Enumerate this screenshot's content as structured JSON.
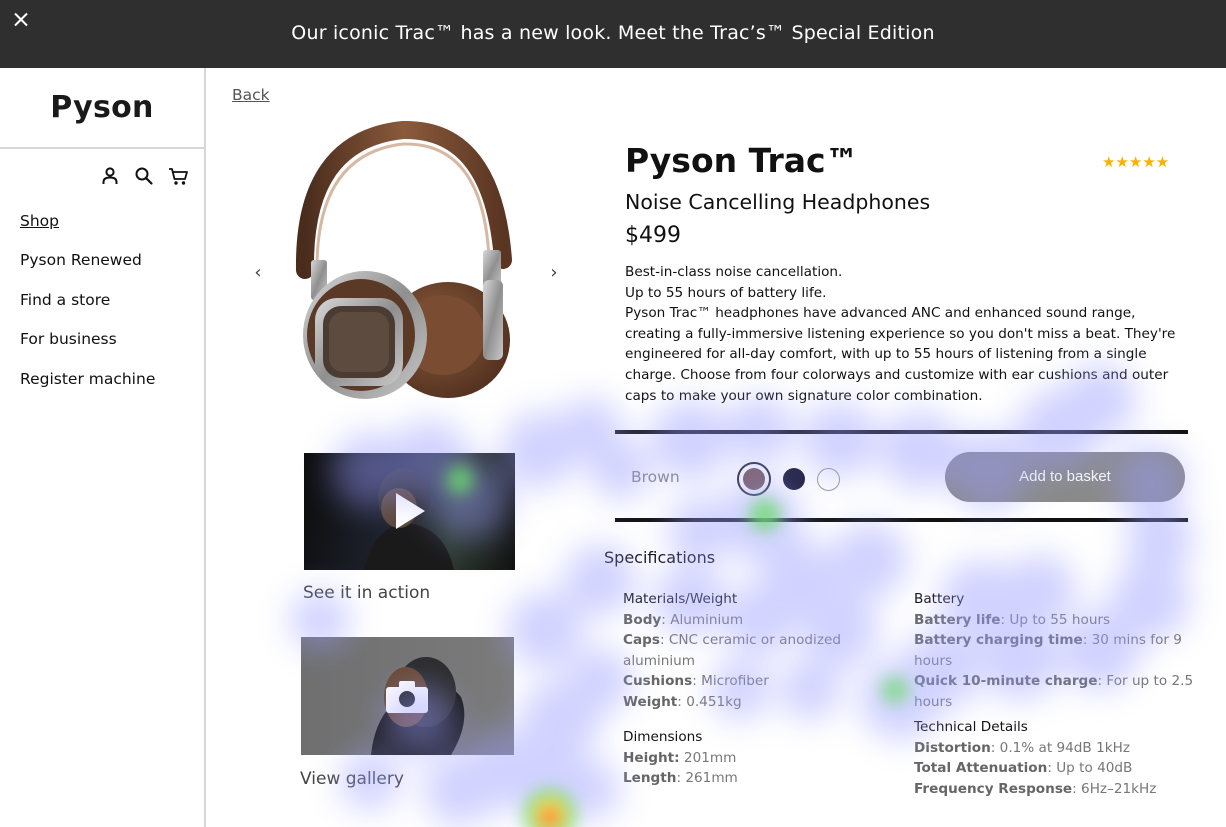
{
  "banner": {
    "close_label": "Close",
    "message": "Our iconic Trac™ has a new look. Meet the Trac’s™ Special Edition"
  },
  "sidebar": {
    "logo": "Pyson",
    "icons": [
      "account-icon",
      "search-icon",
      "cart-icon"
    ],
    "items": [
      {
        "label": "Shop",
        "active": true
      },
      {
        "label": "Pyson Renewed",
        "active": false
      },
      {
        "label": "Find a store",
        "active": false
      },
      {
        "label": "For business",
        "active": false
      },
      {
        "label": "Register machine",
        "active": false
      }
    ]
  },
  "main": {
    "back_label": "Back",
    "gallery": {
      "prev": "‹",
      "next": "›",
      "video_caption": "See it in action",
      "gallery_caption": "View gallery"
    },
    "product": {
      "title": "Pyson Trac™",
      "rating_stars": "★★★★★",
      "rating": 5,
      "subtitle": "Noise Cancelling Headphones",
      "price": "$499",
      "description": [
        "Best-in-class noise cancellation.",
        "Up to 55 hours of battery life.",
        "Pyson Trac™ headphones have advanced ANC and enhanced sound range, creating a fully-immersive listening experience so you don't miss a beat. They're engineered for all-day comfort, with up to 55 hours of listening from a single charge. Choose from four colorways and customize with ear cushions and outer caps to make your own signature color combination."
      ],
      "selected_color": "Brown",
      "colors": [
        {
          "name": "brown",
          "hex": "#7a5a58",
          "selected": true
        },
        {
          "name": "navy",
          "hex": "#1d1d3a",
          "selected": false
        },
        {
          "name": "white",
          "hex": "#ffffff",
          "selected": false
        }
      ],
      "add_to_basket": "Add to basket"
    },
    "specs": {
      "title": "Specifications",
      "materials": {
        "heading": "Materials/Weight",
        "body_k": "Body",
        "body_v": ": Aluminium",
        "caps_k": "Caps",
        "caps_v": ": CNC ceramic or anodized aluminium",
        "cushions_k": "Cushions",
        "cushions_v": ": Microfiber",
        "weight_k": "Weight",
        "weight_v": ": 0.451kg"
      },
      "dimensions": {
        "heading": "Dimensions",
        "height_k": "Height:",
        "height_v": " 201mm",
        "length_k": "Length",
        "length_v": ": 261mm"
      },
      "battery": {
        "heading": "Battery",
        "life_k": "Battery life",
        "life_v": ": Up to 55 hours",
        "charging_k": "Battery charging time",
        "charging_v": ": 30 mins for 9 hours",
        "quick_k": "Quick 10-minute charge",
        "quick_v": ": For up to 2.5 hours"
      },
      "technical": {
        "heading": "Technical Details",
        "distortion_k": "Distortion",
        "distortion_v": ": 0.1% at 94dB 1kHz",
        "attenuation_k": "Total Attenuation",
        "attenuation_v": ": Up to 40dB",
        "frequency_k": "Frequency Response",
        "frequency_v": ": 6Hz–21kHz"
      }
    }
  },
  "theme": {
    "banner_bg": "#2f2f2f",
    "star_color": "#f5b400",
    "button_bg": "#8a8a8a"
  }
}
